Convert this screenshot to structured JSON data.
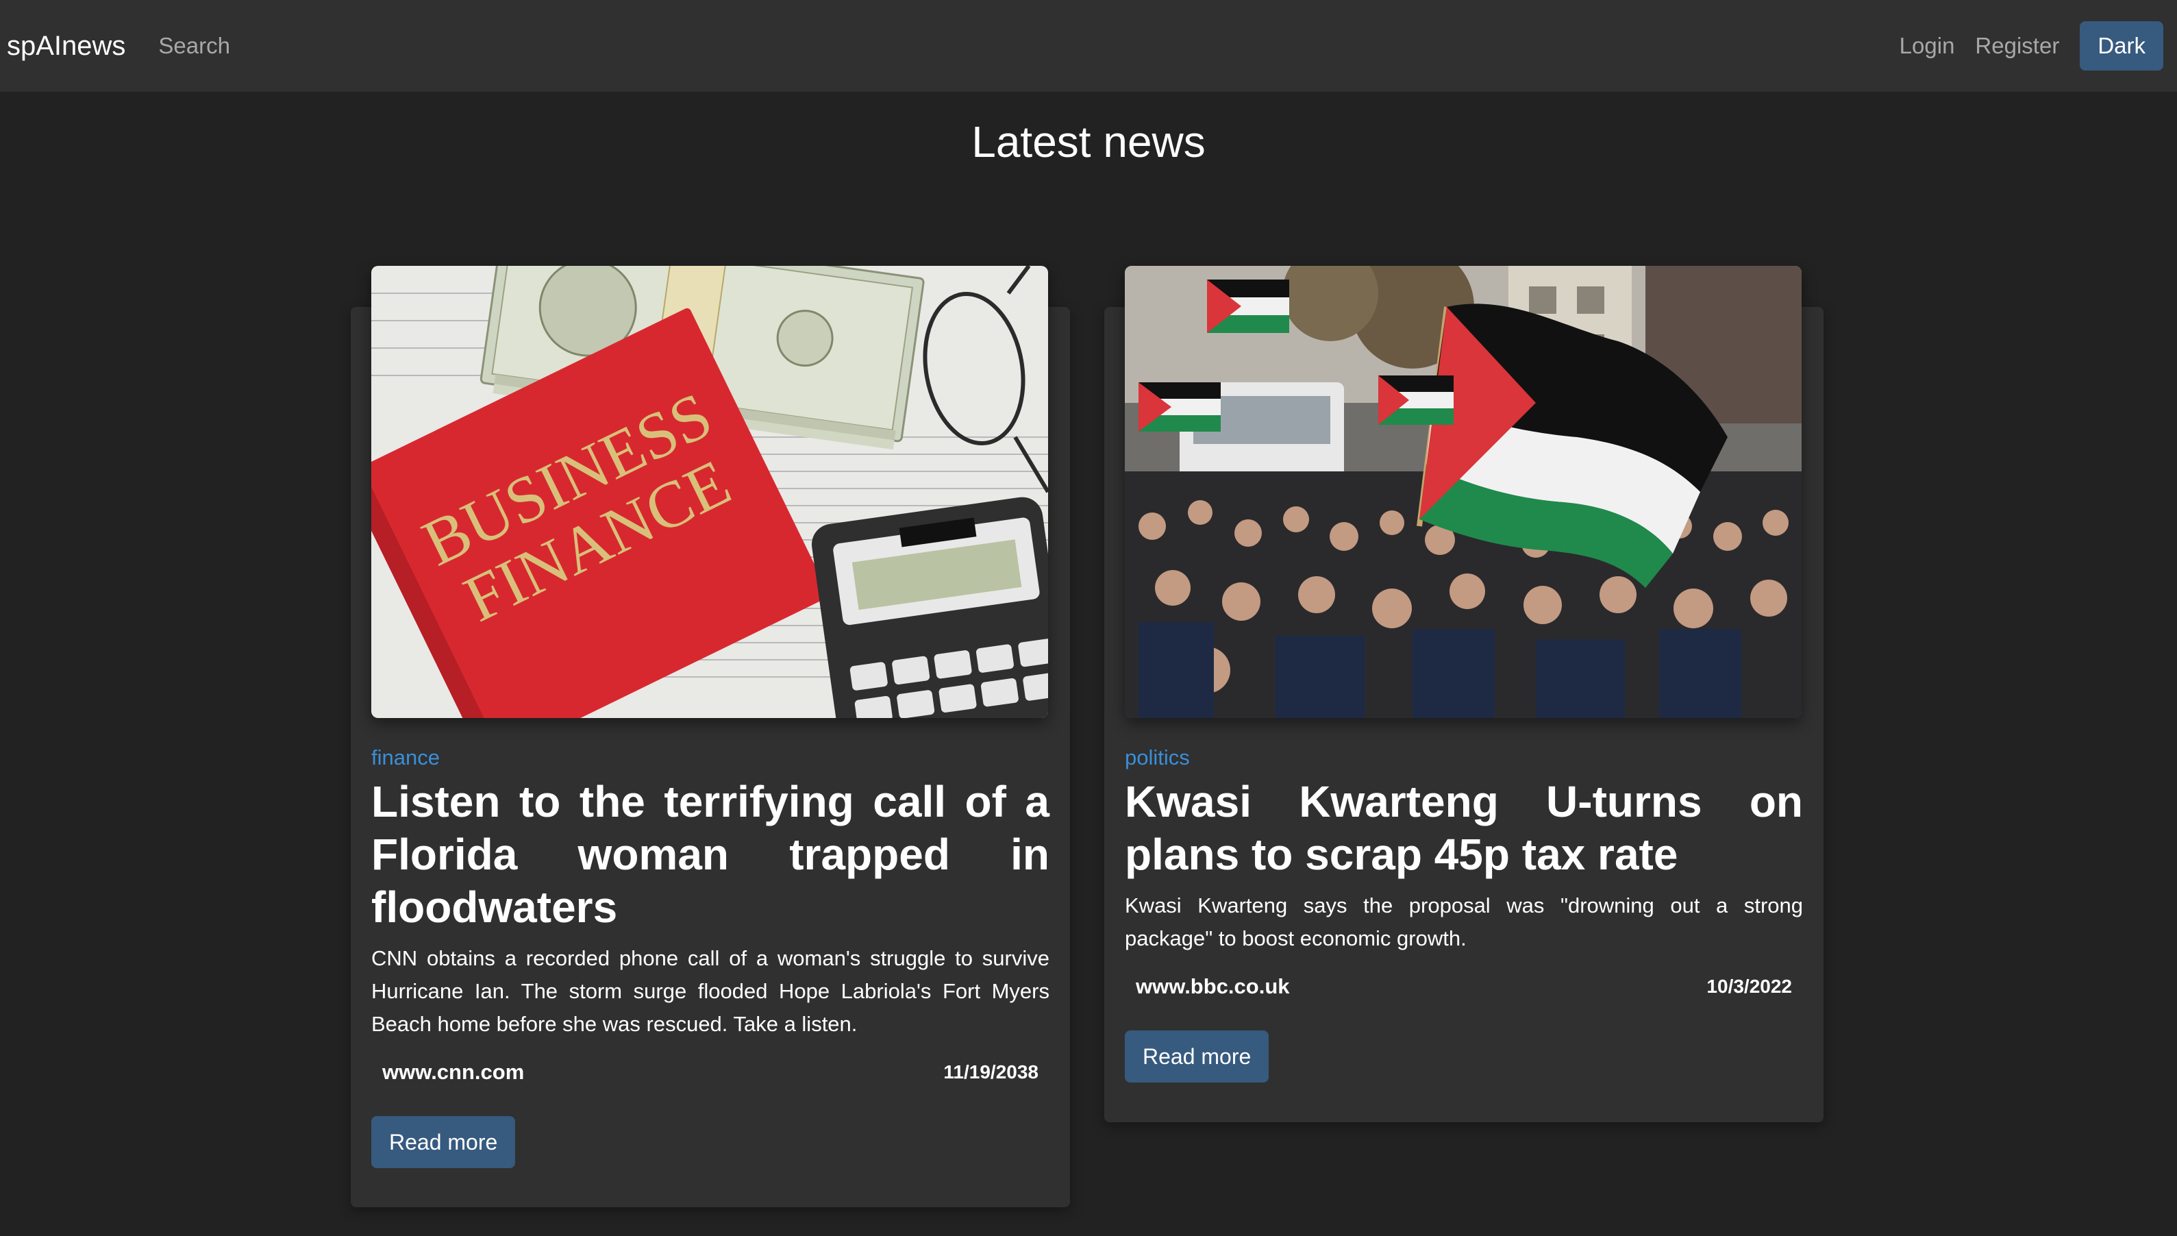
{
  "navbar": {
    "brand": "spAInews",
    "search_label": "Search",
    "login_label": "Login",
    "register_label": "Register",
    "theme_toggle_label": "Dark"
  },
  "main": {
    "title": "Latest news"
  },
  "articles": [
    {
      "category": "finance",
      "headline": "Listen to the terrifying call of a Florida woman trapped in floodwaters",
      "summary": "CNN obtains a recorded phone call of a woman's struggle to survive Hurricane Ian. The storm surge flooded Hope Labriola's Fort Myers Beach home before she was rescued. Take a listen.",
      "source": "www.cnn.com",
      "date": "11/19/2038",
      "read_more_label": "Read more",
      "image": {
        "book_text_line1": "BUSINESS",
        "book_text_line2": "FINANCE"
      }
    },
    {
      "category": "politics",
      "headline": "Kwasi Kwarteng U-turns on plans to scrap 45p tax rate",
      "summary": "Kwasi Kwarteng says the proposal was \"drowning out a strong package\" to boost economic growth.",
      "source": "www.bbc.co.uk",
      "date": "10/3/2022",
      "read_more_label": "Read more"
    }
  ],
  "colors": {
    "background": "#222222",
    "navbar": "#303030",
    "card": "#303030",
    "accent": "#375a7f",
    "category_link": "#3a8fd9"
  }
}
